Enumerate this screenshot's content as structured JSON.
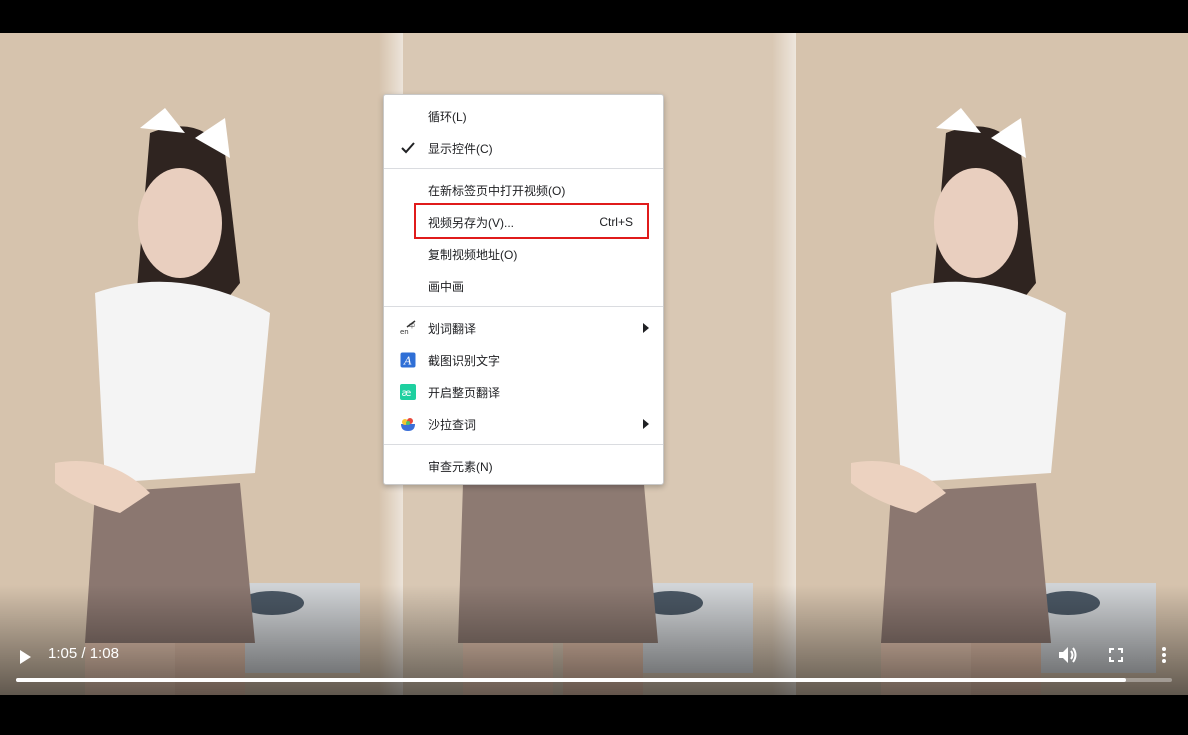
{
  "player": {
    "current_time": "1:05",
    "separator": "/",
    "duration": "1:08",
    "progress": 0.96
  },
  "icons": {
    "play": "play-icon",
    "volume": "volume-icon",
    "fullscreen": "fullscreen-icon",
    "more": "more-vert-icon",
    "check": "checkmark-icon"
  },
  "context_menu": {
    "groups": [
      [
        {
          "label": "循环(L)",
          "checked": false
        },
        {
          "label": "显示控件(C)",
          "checked": true
        }
      ],
      [
        {
          "label": "在新标签页中打开视频(O)"
        },
        {
          "label": "视频另存为(V)...",
          "shortcut": "Ctrl+S",
          "highlighted": true
        },
        {
          "label": "复制视频地址(O)"
        },
        {
          "label": "画中画"
        }
      ],
      [
        {
          "label": "划词翻译",
          "icon": "translate-icon",
          "submenu": true
        },
        {
          "label": "截图识别文字",
          "icon": "ocr-icon"
        },
        {
          "label": "开启整页翻译",
          "icon": "page-translate-icon"
        },
        {
          "label": "沙拉查词",
          "icon": "saladict-icon",
          "submenu": true
        }
      ],
      [
        {
          "label": "审查元素(N)"
        }
      ]
    ]
  },
  "colors": {
    "highlight_border": "#e01b1b",
    "ae_icon": "#1ed0a0",
    "ocr_icon": "#2f6fd6"
  }
}
